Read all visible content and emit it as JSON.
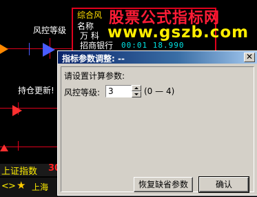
{
  "chart": {
    "label_risk": "风控等级",
    "label_update": "持仓更新!"
  },
  "quote_panel": {
    "title": "综合风",
    "col_name": "名称",
    "row1": "万  科",
    "row2_name": "招商银行",
    "row2_values": "00:01 18.990  0.00%"
  },
  "watermark": {
    "line1": "股票公式指标网",
    "line2": "www.gszb.com"
  },
  "dialog": {
    "title": "指标参数调整: --",
    "close": "✕",
    "prompt": "请设置计算参数:",
    "param_label": "风控等级:",
    "param_value": "3",
    "param_range": "(0 — 4)",
    "reset_button": "恢复缺省参数",
    "ok_button": "确认"
  },
  "bottom": {
    "index_label": "上证指数",
    "index_value": "30",
    "nav_prev": "<",
    "nav_next": ">",
    "star": "★",
    "ticker_label": "上海"
  },
  "colors": {
    "background": "#000000",
    "grid_red": "#e0001c",
    "signal_blue": "#4a5cff",
    "watermark_red": "#ff1c36",
    "watermark_yellow": "#ffee00",
    "dialog_face": "#d4d0c8",
    "titlebar": "#0a246a"
  }
}
